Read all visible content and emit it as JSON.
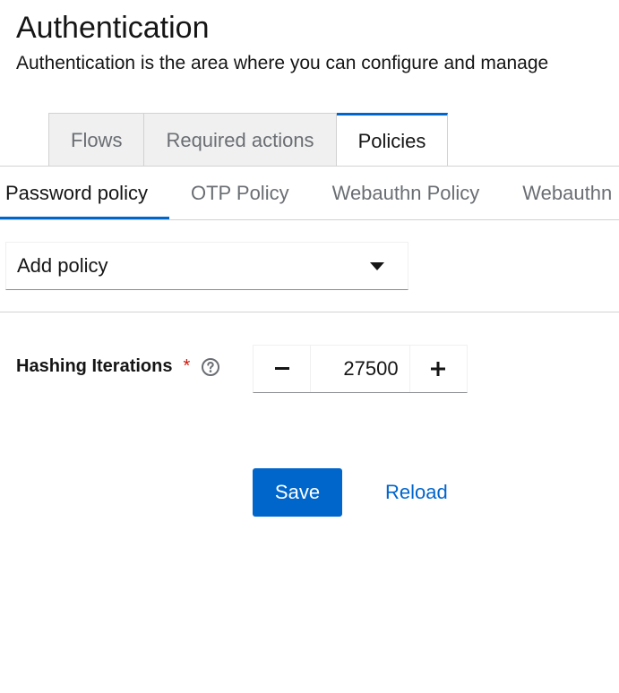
{
  "header": {
    "title": "Authentication",
    "description": "Authentication is the area where you can configure and manage"
  },
  "main_tabs": [
    {
      "label": "Flows",
      "active": false
    },
    {
      "label": "Required actions",
      "active": false
    },
    {
      "label": "Policies",
      "active": true
    }
  ],
  "sub_tabs": [
    {
      "label": "Password policy",
      "active": true
    },
    {
      "label": "OTP Policy",
      "active": false
    },
    {
      "label": "Webauthn Policy",
      "active": false
    },
    {
      "label": "Webauthn Passwordless Policy",
      "active": false
    }
  ],
  "policy_select": {
    "value": "Add policy",
    "icon": "caret-down-icon"
  },
  "hashing": {
    "label": "Hashing Iterations",
    "required_marker": "*",
    "help_icon": "question-circle-icon",
    "value": "27500",
    "minus": "−",
    "plus": "+"
  },
  "actions": {
    "save_label": "Save",
    "reload_label": "Reload"
  },
  "colors": {
    "primary": "#0066cc",
    "required": "#c9190b",
    "tab_inactive_bg": "#f0f0f0",
    "muted_text": "#6a6e73"
  }
}
